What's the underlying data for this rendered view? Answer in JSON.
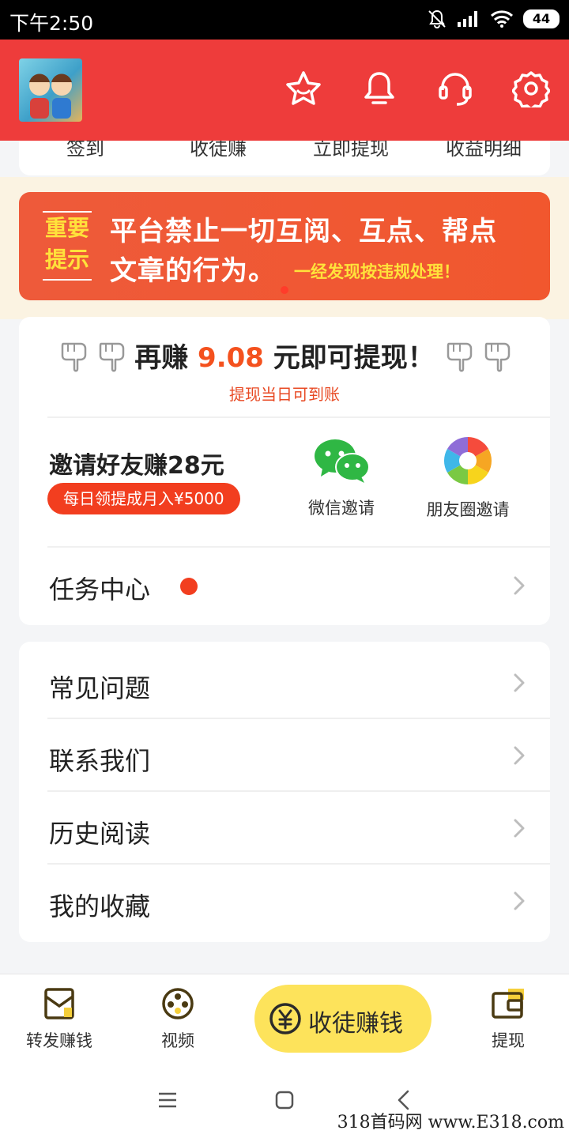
{
  "status_bar": {
    "time": "下午2:50",
    "battery": "44"
  },
  "header": {
    "icons": [
      "avatar",
      "star-icon",
      "bell-icon",
      "headset-icon",
      "settings-icon"
    ]
  },
  "quick_actions": [
    "签到",
    "收徒赚",
    "立即提现",
    "收益明细"
  ],
  "banner": {
    "tag_line1": "重要",
    "tag_line2": "提示",
    "line1": "平台禁止一切互阅、互点、帮点",
    "line2": "文章的行为。",
    "line3": "一经发现按违规处理！"
  },
  "earn": {
    "prefix": "再赚",
    "amount": "9.08",
    "suffix": "元即可提现！",
    "subtext": "提现当日可到账"
  },
  "invite": {
    "title": "邀请好友赚28元",
    "badge": "每日领提成月入¥5000",
    "wechat_label": "微信邀请",
    "moments_label": "朋友圈邀请"
  },
  "task_center": {
    "label": "任务中心"
  },
  "menu": [
    "常见问题",
    "联系我们",
    "历史阅读",
    "我的收藏"
  ],
  "tabbar": {
    "tab1": "转发赚钱",
    "tab2": "视频",
    "center": "收徒赚钱",
    "tab4": "提现"
  },
  "watermark": "318首码网 www.E318.com",
  "colors": {
    "header": "#ee3c3b",
    "accent": "#f4511e",
    "center_button": "#fde35b"
  }
}
